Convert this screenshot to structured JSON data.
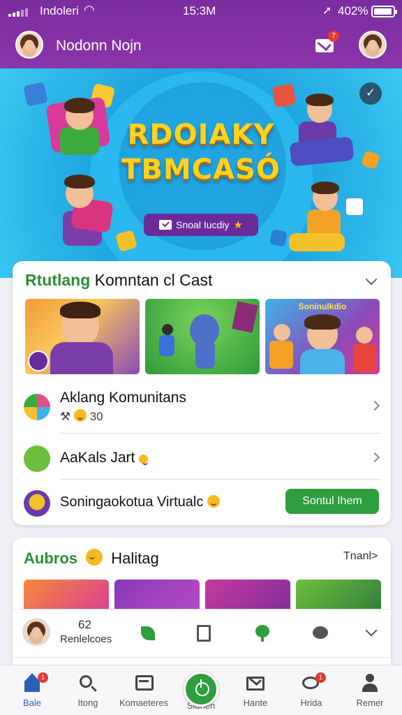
{
  "status_bar": {
    "carrier": "Indoleri",
    "time": "15:3M",
    "battery": "402%"
  },
  "header": {
    "title": "Nodonn Nojn",
    "mail_badge": "7"
  },
  "hero": {
    "title_line1": "RDOIAKY",
    "title_line2": "TBMCASÓ",
    "button_label": "Snoal Iucdiy"
  },
  "community_card": {
    "title_green": "Rtutlang",
    "title_rest": " Komntan cl Cast",
    "rows": [
      {
        "label": "Aklang Komunitans",
        "sub": "30"
      },
      {
        "label": "AaKals Jart"
      },
      {
        "label": "Soningaokotua Virtualc",
        "button": "Sontul Ihem"
      }
    ],
    "thumb_captions": [
      "Soninulkdio"
    ]
  },
  "second_card": {
    "title_green": "Aubros",
    "title_rest": "Halitag",
    "more": "Tnanl>"
  },
  "mini_bar": {
    "count": "62",
    "label": "Renlelcoes"
  },
  "bottom_nav": {
    "items": [
      {
        "label": "Bale",
        "badge": "1"
      },
      {
        "label": "Itong"
      },
      {
        "label": "Komaeteres"
      },
      {
        "label": "Slunen"
      },
      {
        "label": "Hante"
      },
      {
        "label": "Hrida",
        "badge": "1"
      },
      {
        "label": "Remer"
      }
    ]
  }
}
